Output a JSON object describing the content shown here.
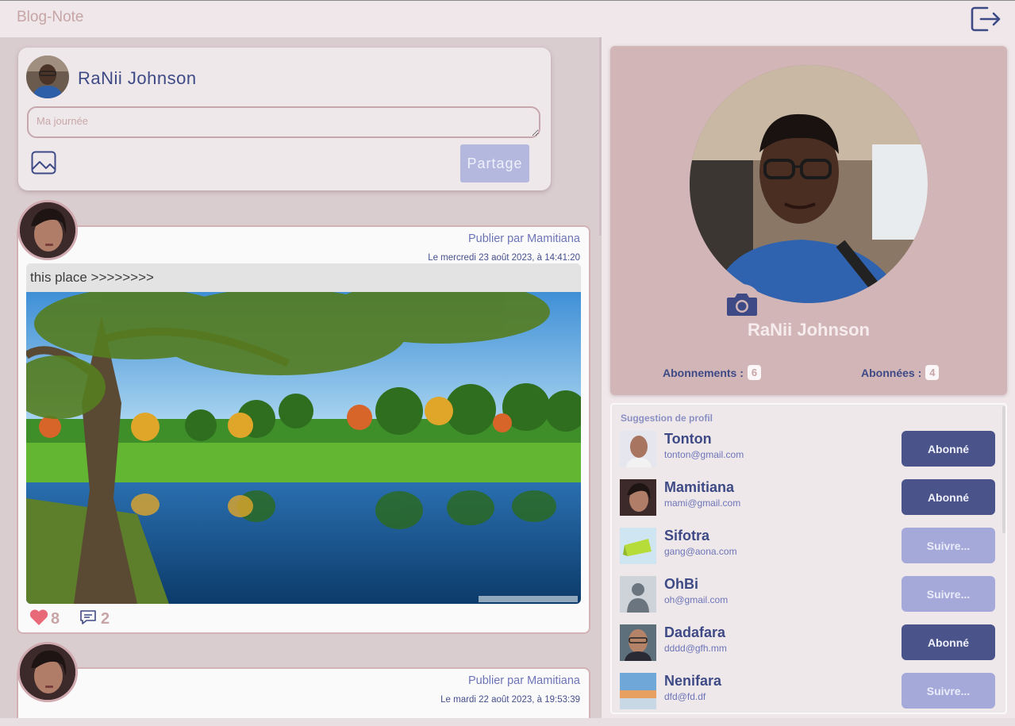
{
  "app": {
    "title": "Blog-Note"
  },
  "composer": {
    "username": "RaNii Johnson",
    "placeholder": "Ma journée",
    "share_label": "Partage"
  },
  "posts": [
    {
      "author": "Publier par Mamitiana",
      "date": "Le mercredi 23 août 2023, à 14:41:20",
      "caption": "this place >>>>>>>>",
      "likes": "8",
      "comments": "2"
    },
    {
      "author": "Publier par Mamitiana",
      "date": "Le mardi 22 août 2023, à 19:53:39"
    }
  ],
  "profile": {
    "name": "RaNii Johnson",
    "following_label": "Abonnements :",
    "following_count": "6",
    "followers_label": "Abonnées :",
    "followers_count": "4"
  },
  "suggestions": {
    "title": "Suggestion de profil",
    "items": [
      {
        "name": "Tonton",
        "email": "tonton@gmail.com",
        "button": "Abonné",
        "state": "following"
      },
      {
        "name": "Mamitiana",
        "email": "mami@gmail.com",
        "button": "Abonné",
        "state": "following"
      },
      {
        "name": "Sifotra",
        "email": "gang@aona.com",
        "button": "Suivre...",
        "state": "follow"
      },
      {
        "name": "OhBi",
        "email": "oh@gmail.com",
        "button": "Suivre...",
        "state": "follow"
      },
      {
        "name": "Dadafara",
        "email": "dddd@gfh.mm",
        "button": "Abonné",
        "state": "following"
      },
      {
        "name": "Nenifara",
        "email": "dfd@fd.df",
        "button": "Suivre...",
        "state": "follow"
      }
    ]
  },
  "colors": {
    "accent": "#3e4a86",
    "muted_pink": "#c7a4a6",
    "follow_button": "#a5a9d9",
    "following_button": "#4a538a",
    "heart": "#e86a78"
  },
  "icons": [
    "logout-icon",
    "image-icon",
    "heart-icon",
    "comment-icon",
    "camera-icon",
    "default-user-icon"
  ]
}
